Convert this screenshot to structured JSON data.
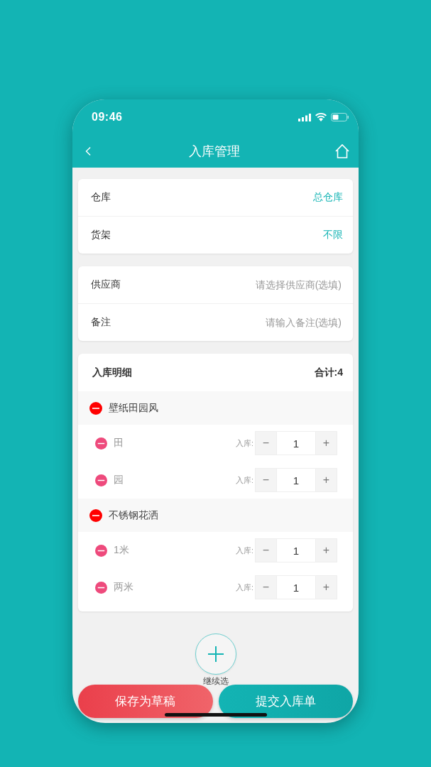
{
  "status_bar": {
    "time": "09:46"
  },
  "header": {
    "title": "入库管理"
  },
  "sections": [
    {
      "rows": [
        {
          "label": "仓库",
          "value": "总仓库",
          "kind": "value"
        },
        {
          "label": "货架",
          "value": "不限",
          "kind": "value"
        }
      ]
    },
    {
      "rows": [
        {
          "label": "供应商",
          "placeholder": "请选择供应商(选填)",
          "kind": "placeholder"
        },
        {
          "label": "备注",
          "placeholder": "请输入备注(选填)",
          "kind": "placeholder"
        }
      ]
    }
  ],
  "details": {
    "title": "入库明细",
    "total": "合计:4",
    "groups": [
      {
        "name": "壁纸田园风",
        "children": [
          {
            "name": "田",
            "label": "入库:",
            "minus": "−",
            "quantity": "1",
            "plus": "+"
          },
          {
            "name": "园",
            "label": "入库:",
            "minus": "−",
            "quantity": "1",
            "plus": "+"
          }
        ]
      },
      {
        "name": "不锈钢花洒",
        "children": [
          {
            "name": "1米",
            "label": "入库:",
            "minus": "−",
            "quantity": "1",
            "plus": "+"
          },
          {
            "name": "两米",
            "label": "入库:",
            "minus": "−",
            "quantity": "1",
            "plus": "+"
          }
        ]
      }
    ]
  },
  "add_button": {
    "label": "继续选"
  },
  "actions": [
    {
      "label": "保存为草稿",
      "kind": "draft"
    },
    {
      "label": "提交入库单",
      "kind": "submit"
    }
  ]
}
